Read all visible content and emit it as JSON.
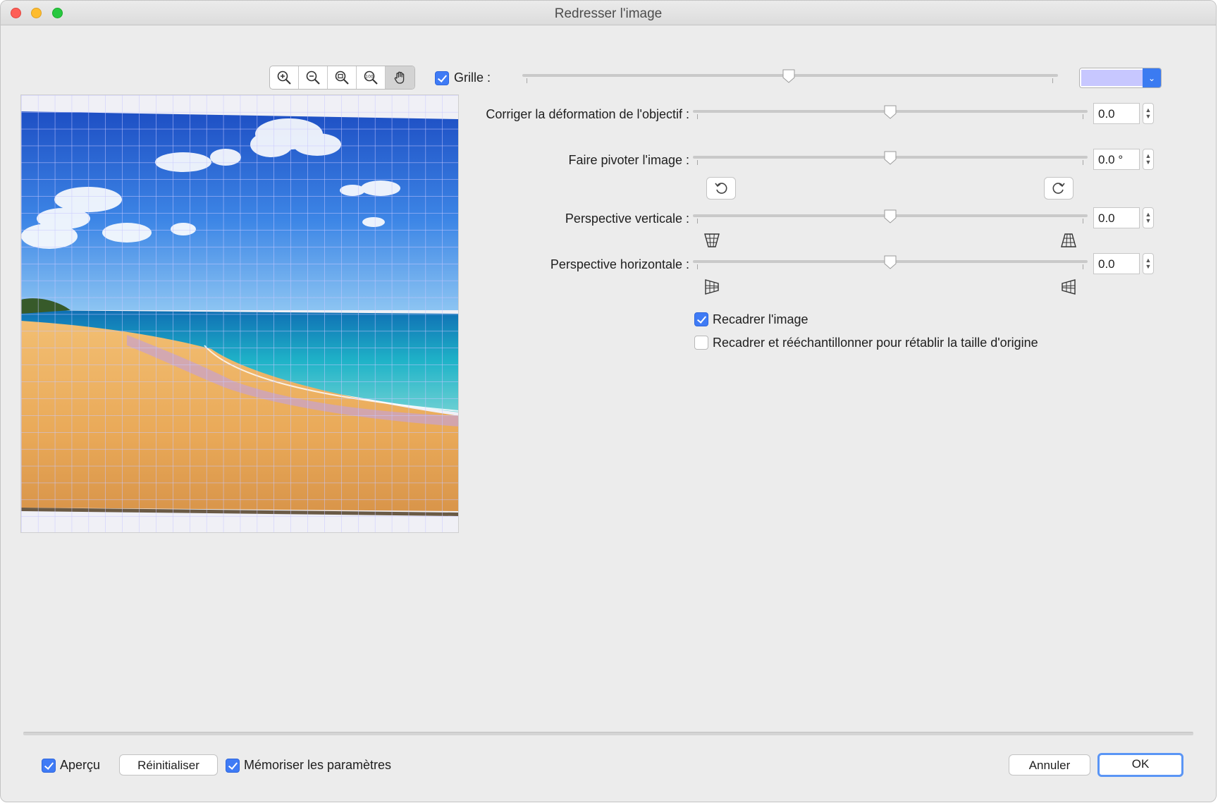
{
  "window": {
    "title": "Redresser l'image"
  },
  "toolbar": {
    "icons": [
      "zoom-in-icon",
      "zoom-out-icon",
      "zoom-fit-icon",
      "zoom-100-icon",
      "hand-icon"
    ]
  },
  "grid": {
    "checked": true,
    "label": "Grille :",
    "color": "#c7c7ff"
  },
  "lens": {
    "label": "Corriger la déformation de l'objectif :",
    "value": "0.0"
  },
  "rotate": {
    "label": "Faire pivoter l'image :",
    "value": "0.0 °"
  },
  "perspective_v": {
    "label": "Perspective verticale :",
    "value": "0.0"
  },
  "perspective_h": {
    "label": "Perspective horizontale :",
    "value": "0.0"
  },
  "crop": {
    "label": "Recadrer l'image",
    "checked": true
  },
  "crop_resample": {
    "label": "Recadrer et rééchantillonner pour rétablir la taille d'origine",
    "checked": false
  },
  "footer": {
    "preview_label": "Aperçu",
    "reset_label": "Réinitialiser",
    "remember_label": "Mémoriser les paramètres",
    "cancel_label": "Annuler",
    "ok_label": "OK"
  },
  "colors": {
    "accent": "#3f7bf5",
    "window_bg": "#ececec"
  }
}
